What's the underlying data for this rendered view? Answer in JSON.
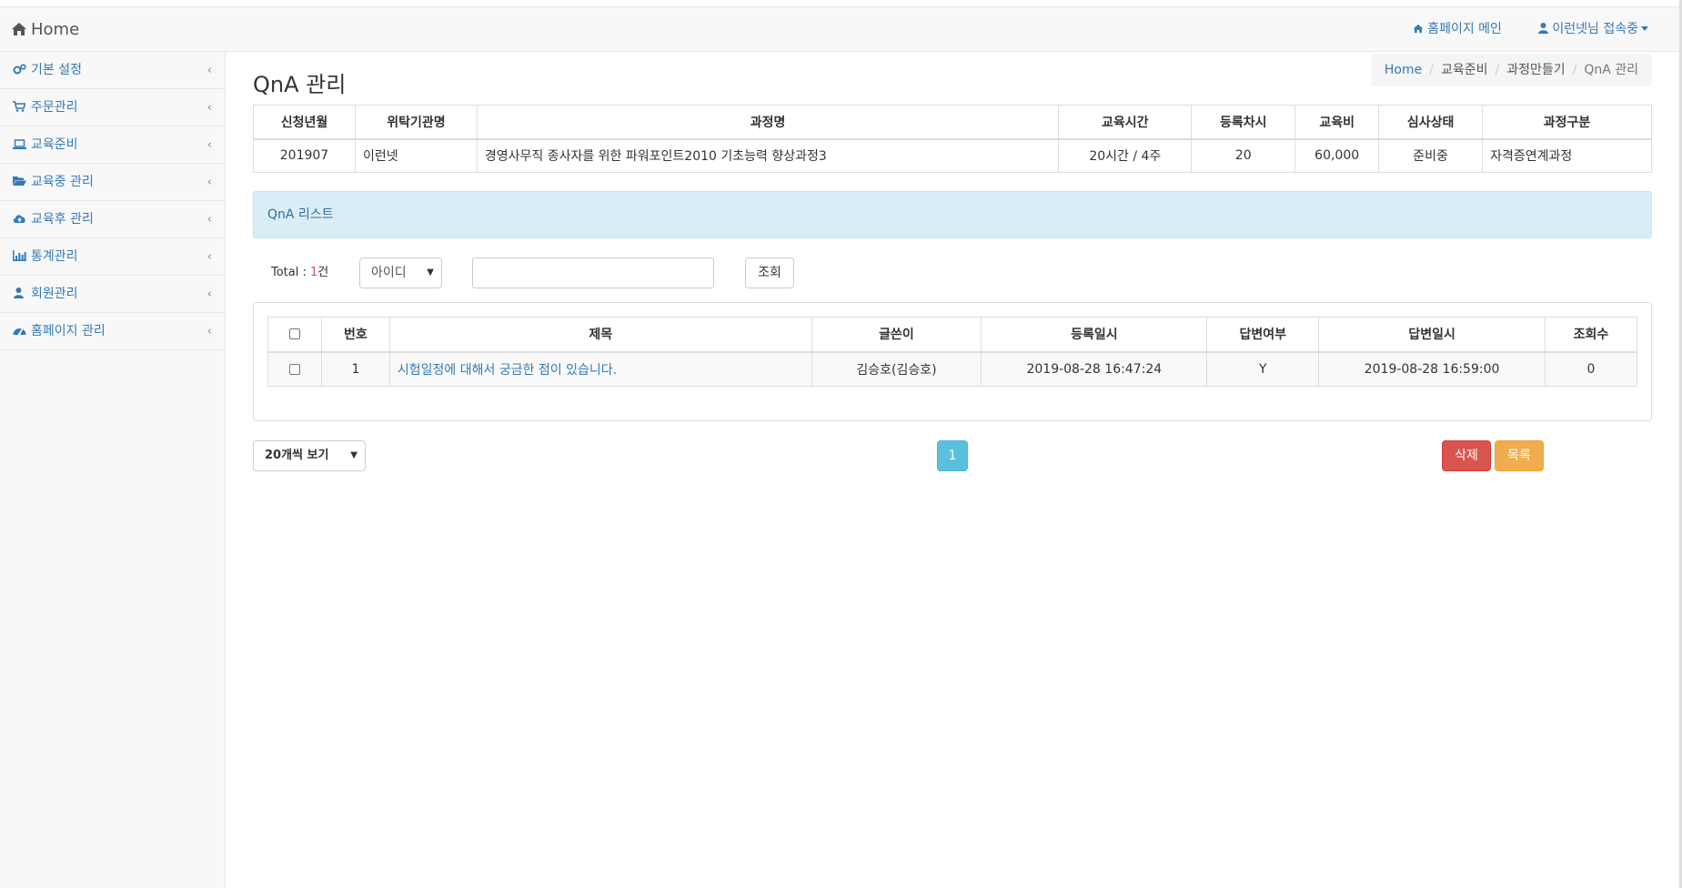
{
  "topbar": {
    "brand": "Home",
    "homepage_link": "홈페이지 메인",
    "user_menu": "이런넷님 접속중"
  },
  "sidebar": {
    "items": [
      {
        "label": "기본 설정",
        "icon": "gears-icon"
      },
      {
        "label": "주문관리",
        "icon": "cart-icon"
      },
      {
        "label": "교육준비",
        "icon": "laptop-icon"
      },
      {
        "label": "교육중 관리",
        "icon": "folder-open-icon"
      },
      {
        "label": "교육후 관리",
        "icon": "cloud-upload-icon"
      },
      {
        "label": "통계관리",
        "icon": "bar-chart-icon"
      },
      {
        "label": "회원관리",
        "icon": "user-icon"
      },
      {
        "label": "홈페이지 관리",
        "icon": "dashboard-icon"
      }
    ]
  },
  "page": {
    "title": "QnA 관리",
    "breadcrumb": [
      "Home",
      "교육준비",
      "과정만들기",
      "QnA 관리"
    ]
  },
  "course_info": {
    "headers": [
      "신청년월",
      "위탁기관명",
      "과정명",
      "교육시간",
      "등록차시",
      "교육비",
      "심사상태",
      "과정구분"
    ],
    "row": [
      "201907",
      "이런넷",
      "경영사무직 종사자를 위한 파워포인트2010 기초능력 향상과정3",
      "20시간 / 4주",
      "20",
      "60,000",
      "준비중",
      "자격증연계과정"
    ]
  },
  "qna_panel": {
    "heading": "QnA 리스트"
  },
  "search": {
    "total_prefix": "Total : ",
    "total_count": "1",
    "total_suffix": "건",
    "field_select": "아이디",
    "query_value": "",
    "search_button": "조회"
  },
  "qna_table": {
    "headers": [
      "번호",
      "제목",
      "글쓴이",
      "등록일시",
      "답변여부",
      "답변일시",
      "조회수"
    ],
    "rows": [
      {
        "no": "1",
        "title": "시험일정에 대해서 궁금한 점이 있습니다.",
        "author": "김승호(김승호)",
        "created": "2019-08-28 16:47:24",
        "answered": "Y",
        "answered_at": "2019-08-28 16:59:00",
        "views": "0"
      }
    ]
  },
  "footer_controls": {
    "page_size_select": "20개씩 보기",
    "current_page": "1",
    "delete_button": "삭제",
    "list_button": "목록"
  },
  "colors": {
    "link": "#337ab7",
    "panel_info_bg": "#d9edf7",
    "pager_active": "#5bc0de",
    "danger": "#d9534f",
    "warning": "#f0ad4e"
  }
}
